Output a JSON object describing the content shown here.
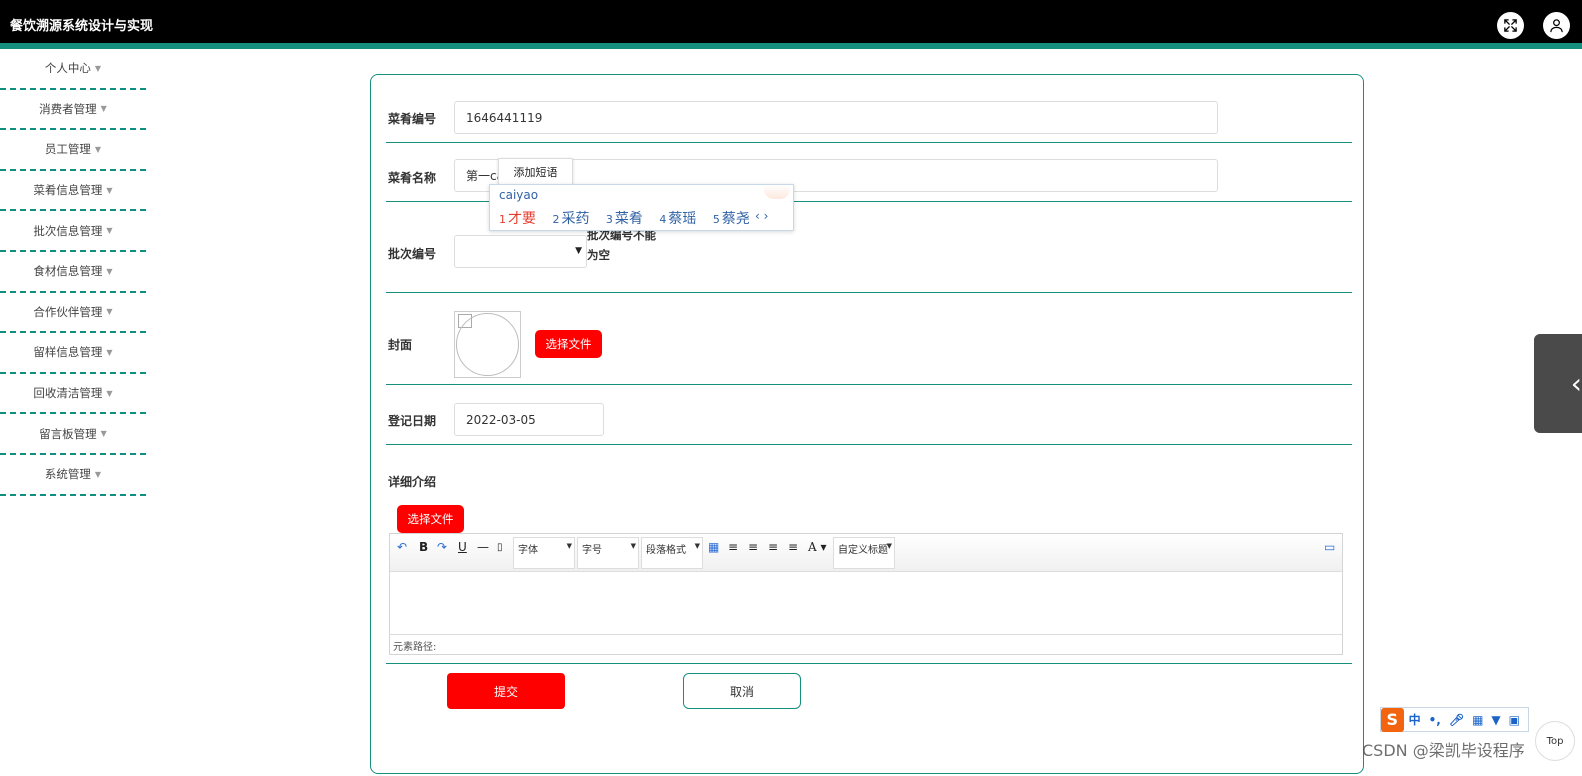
{
  "header": {
    "title": "餐饮溯源系统设计与实现",
    "fullscreen_icon": "fullscreen-icon",
    "user_icon": "user-icon"
  },
  "sidebar": {
    "items": [
      {
        "label": "个人中心"
      },
      {
        "label": "消费者管理"
      },
      {
        "label": "员工管理"
      },
      {
        "label": "菜肴信息管理"
      },
      {
        "label": "批次信息管理"
      },
      {
        "label": "食材信息管理"
      },
      {
        "label": "合作伙伴管理"
      },
      {
        "label": "留样信息管理"
      },
      {
        "label": "回收清洁管理"
      },
      {
        "label": "留言板管理"
      },
      {
        "label": "系统管理"
      }
    ]
  },
  "form": {
    "dish_no": {
      "label": "菜肴编号",
      "value": "1646441119"
    },
    "dish_name": {
      "label": "菜肴名称",
      "value": "第一ca"
    },
    "batch_no": {
      "label": "批次编号",
      "value": "",
      "error": "批次编号不能为空"
    },
    "cover": {
      "label": "封面",
      "upload_label": "选择文件"
    },
    "reg_date": {
      "label": "登记日期",
      "value": "2022-03-05"
    },
    "detail": {
      "label": "详细介绍",
      "upload_label": "选择文件"
    },
    "submit_label": "提交",
    "cancel_label": "取消"
  },
  "editor": {
    "font_label": "字体",
    "size_label": "字号",
    "paragraph_label": "段落格式",
    "custom_title_label": "自定义标题",
    "path_label": "元素路径:"
  },
  "ime": {
    "tip": "添加短语",
    "pinyin": "caiyao",
    "candidates": [
      {
        "n": "1",
        "text": "才要"
      },
      {
        "n": "2",
        "text": "采药"
      },
      {
        "n": "3",
        "text": "菜肴"
      },
      {
        "n": "4",
        "text": "蔡瑶"
      },
      {
        "n": "5",
        "text": "蔡尧"
      }
    ],
    "nav": "‹ ›"
  },
  "sogou_bar": {
    "logo": "S",
    "lang": "中",
    "punct": "•,"
  },
  "top_button": "Top",
  "watermark": "CSDN @梁凯毕设程序"
}
